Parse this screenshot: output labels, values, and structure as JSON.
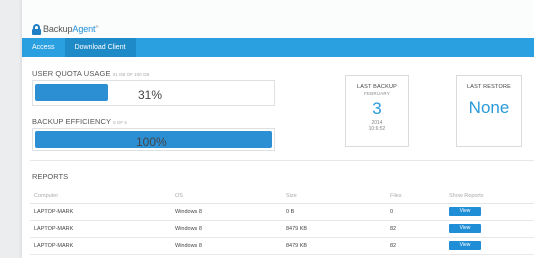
{
  "brand": {
    "name_part1": "Backup",
    "name_part2": "Agent",
    "mark": "®"
  },
  "nav": {
    "items": [
      {
        "label": "Access"
      },
      {
        "label": "Download Client"
      }
    ]
  },
  "quota": {
    "label": "USER QUOTA USAGE",
    "detail": "31 GB OF 100 GB",
    "percent_text": "31%",
    "fraction": 0.31
  },
  "efficiency": {
    "label": "BACKUP EFFICIENCY",
    "detail": "5 OF 5",
    "percent_text": "100%",
    "fraction": 1.0
  },
  "last_backup": {
    "title": "LAST BACKUP",
    "month": "FEBRUARY",
    "day": "3",
    "year": "2014",
    "time": "10:6:52"
  },
  "last_restore": {
    "title": "LAST RESTORE",
    "value": "None"
  },
  "reports": {
    "title": "REPORTS",
    "columns": [
      "Computer",
      "OS",
      "Size",
      "Files",
      "Show Reports"
    ],
    "rows": [
      {
        "computer": "LAPTOP-MARK",
        "os": "Windows 8",
        "size": "0 B",
        "files": "0",
        "action": "View"
      },
      {
        "computer": "LAPTOP-MARK",
        "os": "Windows 8",
        "size": "8479 KB",
        "files": "82",
        "action": "View"
      },
      {
        "computer": "LAPTOP-MARK",
        "os": "Windows 8",
        "size": "8479 KB",
        "files": "82",
        "action": "View"
      }
    ]
  },
  "colors": {
    "accent": "#2aa0e0",
    "bar": "#2c8fd4",
    "big_number": "#2a9bd8"
  }
}
